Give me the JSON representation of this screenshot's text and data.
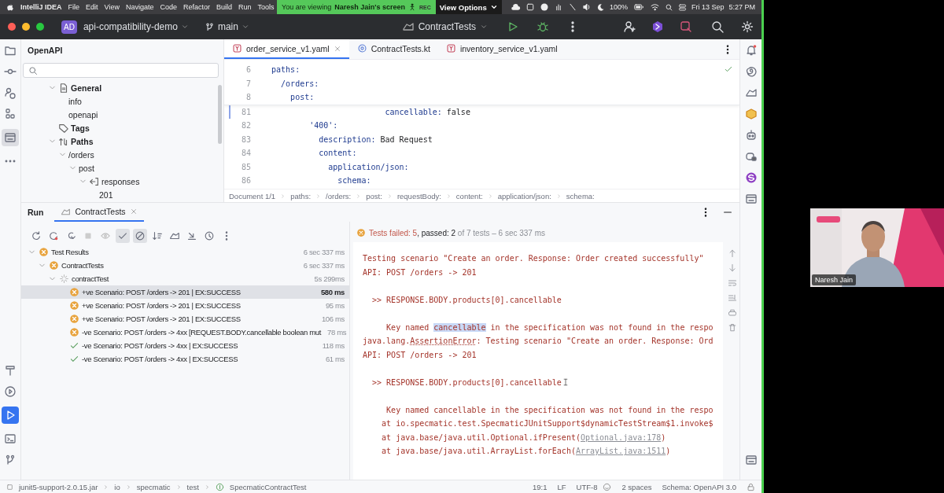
{
  "menu_bar": {
    "items": [
      "IntelliJ IDEA",
      "File",
      "Edit",
      "View",
      "Navigate",
      "Code",
      "Refactor",
      "Build",
      "Run",
      "Tools"
    ],
    "battery": "100%",
    "date": "Fri 13 Sep",
    "time": "5:27 PM"
  },
  "share_banner": {
    "prefix": "You are viewing",
    "presenter": "Naresh Jain's screen",
    "rec": "REC",
    "options": "View Options"
  },
  "title_bar": {
    "project_badge": "AD",
    "project": "api-compatibility-demo",
    "branch": "main",
    "run_config": "ContractTests"
  },
  "project_panel": {
    "title": "OpenAPI",
    "tree": [
      {
        "label": "General",
        "kind": "document",
        "expanded": true,
        "children": [
          {
            "label": "info"
          },
          {
            "label": "openapi"
          }
        ]
      },
      {
        "label": "Tags",
        "kind": "tag"
      },
      {
        "label": "Paths",
        "kind": "paths",
        "expanded": true,
        "children": [
          {
            "label": "/orders",
            "expanded": true,
            "children": [
              {
                "label": "post",
                "expanded": true,
                "children": [
                  {
                    "label": "responses",
                    "kind": "responses",
                    "expanded": true,
                    "children": [
                      {
                        "label": "201"
                      }
                    ]
                  }
                ]
              }
            ]
          }
        ]
      }
    ]
  },
  "editor": {
    "tabs": [
      {
        "label": "order_service_v1.yaml",
        "kind": "yaml",
        "selected": true
      },
      {
        "label": "ContractTests.kt",
        "kind": "kotlin",
        "selected": false
      },
      {
        "label": "inventory_service_v1.yaml",
        "kind": "yaml",
        "selected": false
      }
    ],
    "sticky_lines": [
      {
        "num": "6",
        "key": "  paths:"
      },
      {
        "num": "7",
        "key": "    /orders:"
      },
      {
        "num": "8",
        "key": "      post:"
      }
    ],
    "lines": [
      {
        "num": "81",
        "key": "                          cancellable:",
        "value": " false",
        "changed": true
      },
      {
        "num": "82",
        "key": "          '400':",
        "changed": false
      },
      {
        "num": "83",
        "key": "            description:",
        "value": " Bad Request",
        "changed": false
      },
      {
        "num": "84",
        "key": "            content:",
        "changed": false
      },
      {
        "num": "85",
        "key": "              application/json:",
        "changed": false
      },
      {
        "num": "86",
        "key": "                schema:",
        "changed": false
      }
    ],
    "breadcrumbs": [
      "Document 1/1",
      "paths:",
      "/orders:",
      "post:",
      "requestBody:",
      "content:",
      "application/json:",
      "schema:"
    ]
  },
  "run_panel": {
    "title": "Run",
    "tab": {
      "label": "ContractTests",
      "selected": true
    },
    "toolbar": [
      {
        "kind": "rerun",
        "on": false
      },
      {
        "kind": "rerun-failed",
        "on": false
      },
      {
        "kind": "toggle-auto",
        "on": false
      },
      {
        "kind": "stop",
        "on": false
      },
      {
        "kind": "eye",
        "on": false
      },
      {
        "kind": "show-passed",
        "on": true
      },
      {
        "kind": "show-ignored",
        "on": true
      },
      {
        "kind": "sort",
        "on": false
      },
      {
        "kind": "import",
        "on": false
      },
      {
        "kind": "export",
        "on": false
      },
      {
        "kind": "history",
        "on": false
      },
      {
        "kind": "more",
        "on": false
      }
    ],
    "tests": [
      {
        "label": "Test Results",
        "kind": "failed",
        "time": "6 sec 337 ms",
        "expanded": true,
        "selected": false,
        "children": [
          {
            "label": "ContractTests",
            "kind": "failed",
            "time": "6 sec 337 ms",
            "expanded": true,
            "selected": false,
            "children": [
              {
                "label": "contractTest",
                "kind": "running",
                "time": "5s 299ms",
                "expanded": true,
                "selected": false,
                "children": [
                  {
                    "label": "+ve Scenario: POST /orders -> 201 | EX:SUCCESS",
                    "kind": "failed",
                    "time": "580 ms",
                    "selected": true
                  },
                  {
                    "label": "+ve Scenario: POST /orders -> 201 | EX:SUCCESS",
                    "kind": "failed",
                    "time": "95 ms",
                    "selected": false
                  },
                  {
                    "label": "+ve Scenario: POST /orders -> 201 | EX:SUCCESS",
                    "kind": "failed",
                    "time": "106 ms",
                    "selected": false
                  },
                  {
                    "label": "-ve Scenario: POST /orders -> 4xx [REQUEST.BODY.cancellable boolean mut",
                    "kind": "failed",
                    "time": "78 ms",
                    "selected": false
                  },
                  {
                    "label": "-ve Scenario: POST /orders -> 4xx | EX:SUCCESS",
                    "kind": "passed",
                    "time": "118 ms",
                    "selected": false
                  },
                  {
                    "label": "-ve Scenario: POST /orders -> 4xx | EX:SUCCESS",
                    "kind": "passed",
                    "time": "61 ms",
                    "selected": false
                  }
                ]
              }
            ]
          }
        ]
      }
    ],
    "summary": [
      {
        "text": "Tests failed: 5",
        "kind": "failed"
      },
      {
        "text": ", passed: 2",
        "kind": "passed"
      },
      {
        "text": " of 7 tests – 6 sec 337 ms",
        "kind": "meta"
      }
    ],
    "console": [
      {
        "parts": [
          {
            "text": "Testing scenario \"Create an order. Response: Order created successfully\"",
            "kind": "plain"
          }
        ],
        "gap_before": false,
        "cursor": false
      },
      {
        "parts": [
          {
            "text": "API: POST /orders -> 201",
            "kind": "plain"
          }
        ],
        "gap_before": false,
        "cursor": false
      },
      {
        "parts": [
          {
            "text": "  >> RESPONSE.BODY.products[0].cancellable",
            "kind": "plain"
          }
        ],
        "gap_before": true,
        "cursor": false
      },
      {
        "parts": [
          {
            "text": "     Key named ",
            "kind": "plain"
          },
          {
            "text": "cancellable",
            "kind": "selected"
          },
          {
            "text": " in the specification was not found in the respo",
            "kind": "plain"
          }
        ],
        "gap_before": true,
        "cursor": false
      },
      {
        "parts": [
          {
            "text": "java.lang.",
            "kind": "plain"
          },
          {
            "text": "AssertionError",
            "kind": "underlined"
          },
          {
            "text": ": Testing scenario \"Create an order. Response: Ord",
            "kind": "plain"
          }
        ],
        "gap_before": false,
        "cursor": false
      },
      {
        "parts": [
          {
            "text": "API: POST /orders -> 201",
            "kind": "plain"
          }
        ],
        "gap_before": false,
        "cursor": false
      },
      {
        "parts": [
          {
            "text": "  >> RESPONSE.BODY.products[0].cancellable",
            "kind": "plain"
          }
        ],
        "gap_before": true,
        "cursor": true
      },
      {
        "parts": [
          {
            "text": "     Key named cancellable in the specification was not found in the respo",
            "kind": "plain"
          }
        ],
        "gap_before": true,
        "cursor": false
      },
      {
        "parts": [
          {
            "text": "    at io.specmatic.test.SpecmaticJUnitSupport$dynamicTestStream$1.invoke$",
            "kind": "plain"
          }
        ],
        "gap_before": false,
        "cursor": false
      },
      {
        "parts": [
          {
            "text": "    at java.base/java.util.Optional.ifPresent(",
            "kind": "plain"
          },
          {
            "text": "Optional.java:178",
            "kind": "link"
          },
          {
            "text": ")",
            "kind": "plain"
          }
        ],
        "gap_before": false,
        "cursor": false
      },
      {
        "parts": [
          {
            "text": "    at java.base/java.util.ArrayList.forEach(",
            "kind": "plain"
          },
          {
            "text": "ArrayList.java:1511",
            "kind": "link"
          },
          {
            "text": ")",
            "kind": "plain"
          }
        ],
        "gap_before": false,
        "cursor": false
      }
    ]
  },
  "status_bar": {
    "path": [
      "junit5-support-2.0.15.jar",
      "io",
      "specmatic",
      "test",
      "SpecmaticContractTest"
    ],
    "items": [
      "19:1",
      "LF",
      "UTF-8",
      "2 spaces",
      "Schema: OpenAPI 3.0"
    ]
  },
  "webcam": {
    "name": "Naresh Jain"
  }
}
